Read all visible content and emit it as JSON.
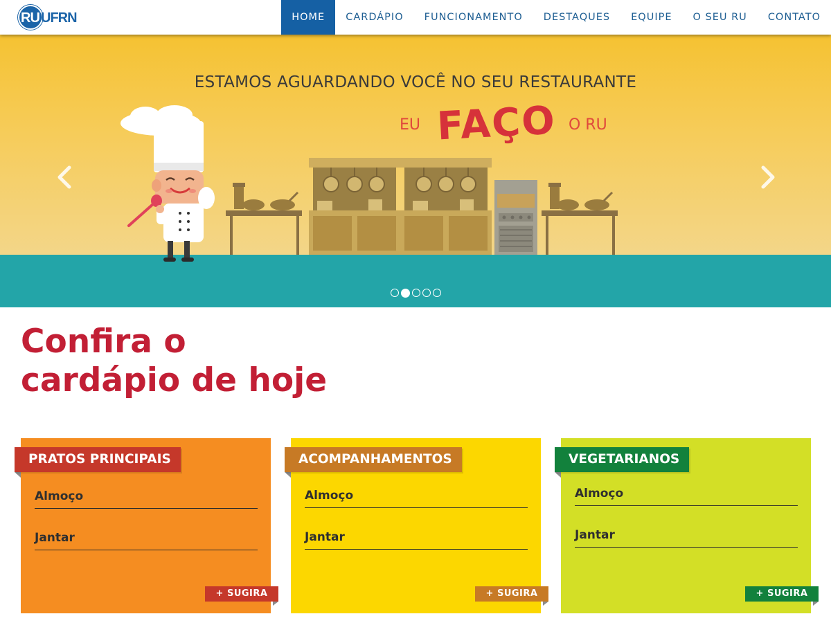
{
  "brand": {
    "logo_ru": "RU",
    "logo_ufrn": "UFRN",
    "primary_color": "#1560a4"
  },
  "nav": {
    "items": [
      {
        "label": "HOME",
        "active": true
      },
      {
        "label": "CARDÁPIO",
        "active": false
      },
      {
        "label": "FUNCIONAMENTO",
        "active": false
      },
      {
        "label": "DESTAQUES",
        "active": false
      },
      {
        "label": "EQUIPE",
        "active": false
      },
      {
        "label": "O SEU RU",
        "active": false
      },
      {
        "label": "CONTATO",
        "active": false
      }
    ]
  },
  "hero": {
    "headline": "ESTAMOS AGUARDANDO VOCÊ NO SEU RESTAURANTE",
    "slogan_eu": "EU",
    "slogan_faco": "FAÇO",
    "slogan_oru": "O RU",
    "prev_icon": "chevron-left-icon",
    "next_icon": "chevron-right-icon",
    "slide_count": 5,
    "active_slide": 2,
    "sky_color": "#f5c232",
    "floor_color": "#23a5a8"
  },
  "menu": {
    "title_line1": "Confira o",
    "title_line2": "cardápio de hoje",
    "title_color": "#c21f35",
    "cards": [
      {
        "title": "PRATOS PRINCIPAIS",
        "lunch": "Almoço",
        "dinner": "Jantar",
        "suggest": "+ SUGIRA",
        "bg": "#f58d21",
        "ribbon": "#c5382a"
      },
      {
        "title": "ACOMPANHAMENTOS",
        "lunch": "Almoço",
        "dinner": "Jantar",
        "suggest": "+ SUGIRA",
        "bg": "#fcd700",
        "ribbon": "#c77a25"
      },
      {
        "title": "VEGETARIANOS",
        "lunch": "Almoço",
        "dinner": "Jantar",
        "suggest": "+ SUGIRA",
        "bg": "#d3df26",
        "ribbon": "#12813c"
      }
    ]
  }
}
